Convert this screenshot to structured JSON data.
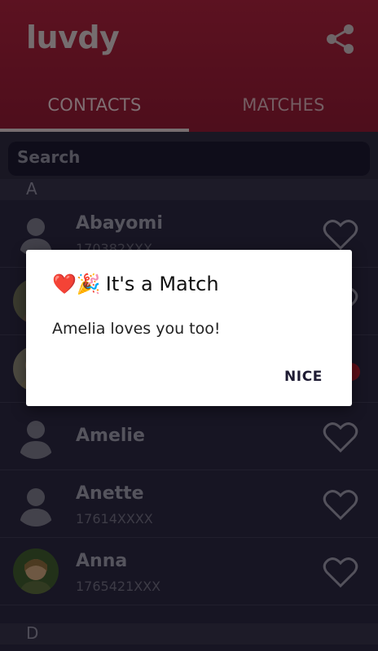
{
  "app": {
    "title": "luvdy"
  },
  "tabs": [
    {
      "label": "CONTACTS",
      "active": true
    },
    {
      "label": "MATCHES",
      "active": false
    }
  ],
  "search": {
    "placeholder": "Search"
  },
  "sections": [
    {
      "letter": "A"
    },
    {
      "letter": "D"
    }
  ],
  "contacts": [
    {
      "name": "Abayomi",
      "phone": "170382XXX",
      "avatar": "placeholder",
      "liked": false
    },
    {
      "name": "",
      "phone": "",
      "avatar": "photo",
      "liked": false
    },
    {
      "name": "",
      "phone": "",
      "avatar": "photo",
      "liked": true
    },
    {
      "name": "Amelie",
      "phone": "",
      "avatar": "placeholder",
      "liked": false
    },
    {
      "name": "Anette",
      "phone": "17614XXXX",
      "avatar": "placeholder",
      "liked": false
    },
    {
      "name": "Anna",
      "phone": "1765421XXX",
      "avatar": "photo",
      "liked": false
    }
  ],
  "dialog": {
    "emoji": "❤️🎉",
    "title": "It's a Match",
    "message": "Amelia loves you too!",
    "button": "NICE"
  },
  "colors": {
    "header": "#a8213c",
    "background": "#2a2740",
    "accent": "#b01c2c"
  },
  "icons": {
    "share": "share-icon",
    "heart": "heart-outline-icon"
  }
}
